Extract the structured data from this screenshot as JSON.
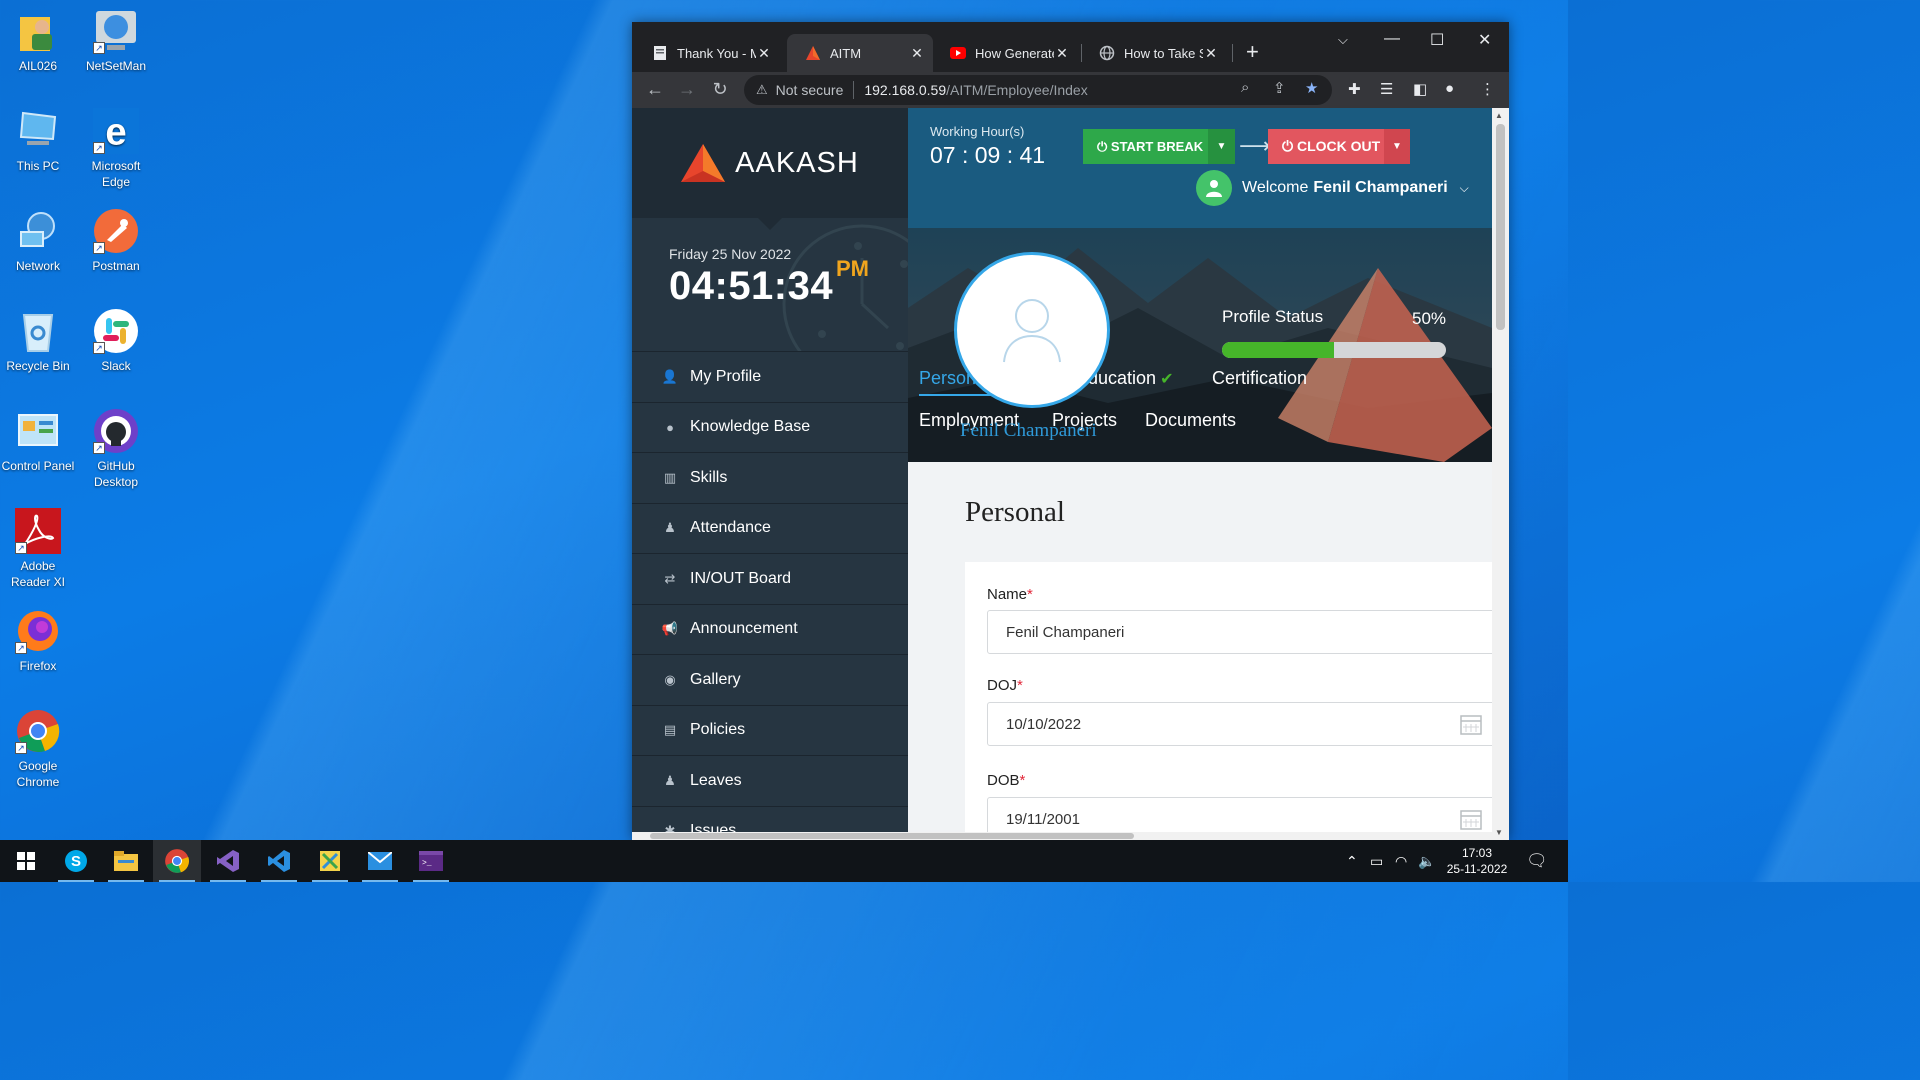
{
  "desktop": {
    "icons": [
      {
        "label": "AIL026"
      },
      {
        "label": "NetSetMan"
      },
      {
        "label": "This PC"
      },
      {
        "label": "Microsoft Edge"
      },
      {
        "label": "Network"
      },
      {
        "label": "Postman"
      },
      {
        "label": "Recycle Bin"
      },
      {
        "label": "Slack"
      },
      {
        "label": "Control Panel"
      },
      {
        "label": "GitHub Desktop"
      },
      {
        "label": "Adobe Reader XI"
      },
      {
        "label": "Firefox"
      },
      {
        "label": "Google Chrome"
      }
    ]
  },
  "browser": {
    "tabs": [
      {
        "title": "Thank You - My"
      },
      {
        "title": "AITM"
      },
      {
        "title": "How Generate"
      },
      {
        "title": "How to Take Sc"
      }
    ],
    "address": {
      "security": "Not secure",
      "host": "192.168.0.59",
      "path": "/AITM/Employee/Index"
    }
  },
  "app": {
    "brand": "AAKASH",
    "clock": {
      "date": "Friday 25 Nov 2022",
      "time": "04:51:34",
      "ampm": "PM"
    },
    "menu": [
      {
        "label": "My Profile",
        "icon": "user-icon"
      },
      {
        "label": "Knowledge Base",
        "icon": "comment-icon"
      },
      {
        "label": "Skills",
        "icon": "bar-chart-icon"
      },
      {
        "label": "Attendance",
        "icon": "person-icon"
      },
      {
        "label": "IN/OUT Board",
        "icon": "exchange-icon"
      },
      {
        "label": "Announcement",
        "icon": "megaphone-icon"
      },
      {
        "label": "Gallery",
        "icon": "camera-icon"
      },
      {
        "label": "Policies",
        "icon": "document-icon"
      },
      {
        "label": "Leaves",
        "icon": "person-icon"
      },
      {
        "label": "Issues",
        "icon": "bug-icon"
      }
    ],
    "header": {
      "working_label": "Working Hour(s)",
      "working_time": "07 : 09 : 41",
      "start_break": "START BREAK",
      "clock_out": "CLOCK OUT",
      "welcome": "Welcome",
      "user": "Fenil Champaneri"
    },
    "profile": {
      "name": "Fenil Champaneri",
      "status_label": "Profile Status",
      "status_pct": "50%",
      "status_value": 0.5,
      "tabs": [
        {
          "label": "Personal Info",
          "done": true
        },
        {
          "label": "Education",
          "done": true
        },
        {
          "label": "Certification"
        },
        {
          "label": "Employment"
        },
        {
          "label": "Projects"
        },
        {
          "label": "Documents"
        }
      ]
    },
    "form": {
      "title": "Personal",
      "name_label": "Name",
      "name_value": "Fenil Champaneri",
      "doj_label": "DOJ",
      "doj_value": "10/10/2022",
      "dob_label": "DOB",
      "dob_value": "19/11/2001",
      "required_mark": "*"
    }
  },
  "taskbar": {
    "time": "17:03",
    "date": "25-11-2022"
  },
  "colors": {
    "sidebar": "#263541",
    "header": "#1a5b80",
    "accent": "#35a7e8",
    "start_break": "#2ea84a",
    "clock_out": "#e2565f",
    "clock_ampm": "#f0a51e"
  }
}
